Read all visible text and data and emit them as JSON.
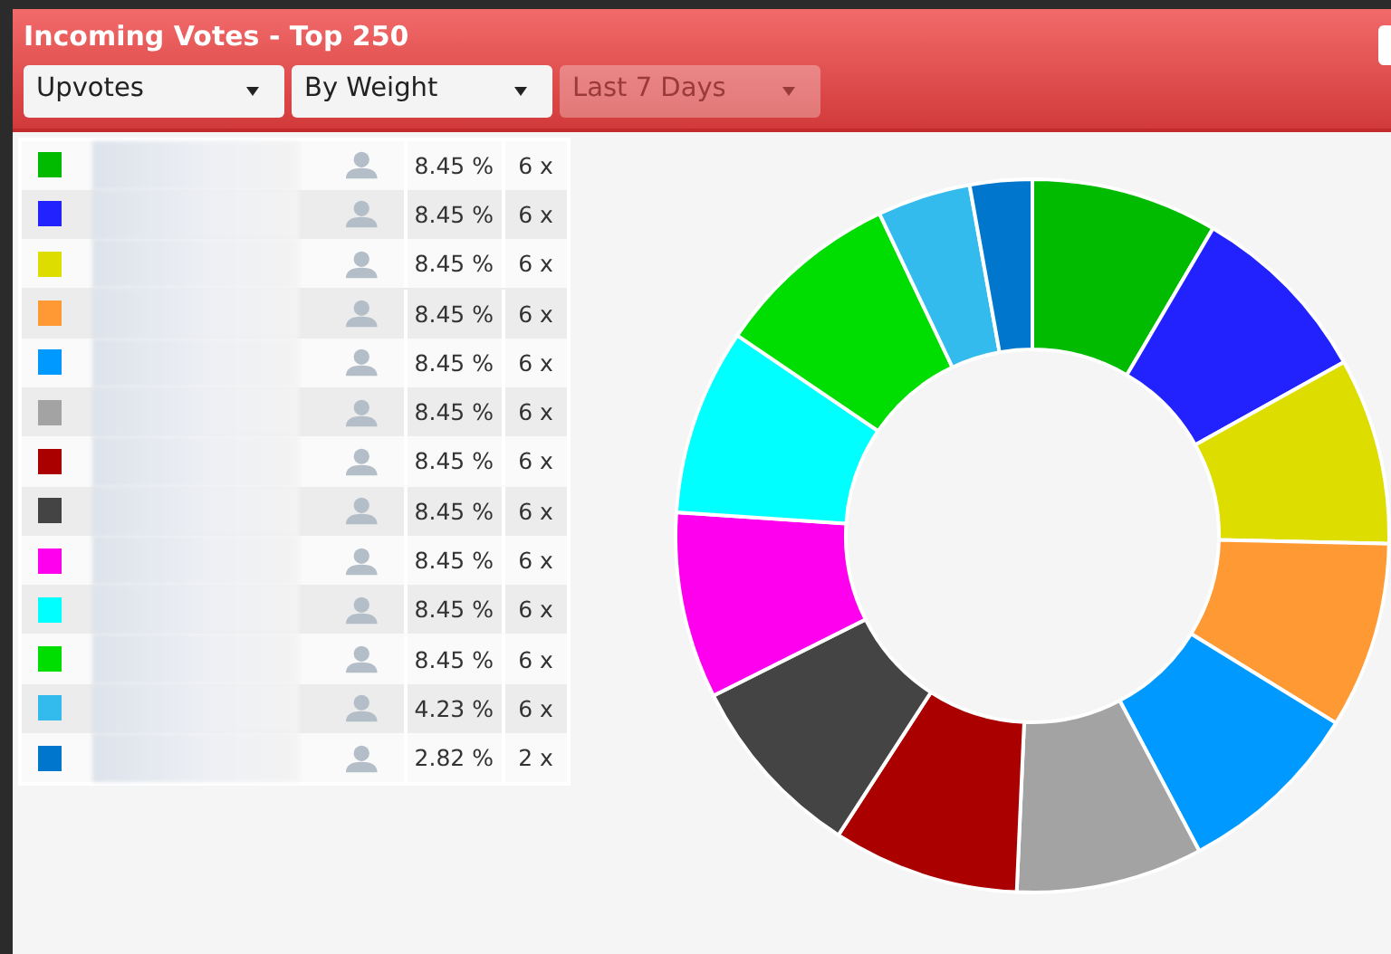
{
  "panel": {
    "title": "Incoming Votes - Top 250"
  },
  "filters": [
    {
      "value": "Upvotes",
      "disabled": false
    },
    {
      "value": "By Weight",
      "disabled": false
    },
    {
      "value": "Last 7 Days",
      "disabled": true
    }
  ],
  "rows": [
    {
      "color": "#00bb00",
      "share": "8.45 %",
      "count": "6 x"
    },
    {
      "color": "#2222ff",
      "share": "8.45 %",
      "count": "6 x"
    },
    {
      "color": "#dddd00",
      "share": "8.45 %",
      "count": "6 x"
    },
    {
      "color": "#ff9933",
      "share": "8.45 %",
      "count": "6 x"
    },
    {
      "color": "#0099ff",
      "share": "8.45 %",
      "count": "6 x"
    },
    {
      "color": "#a3a3a3",
      "share": "8.45 %",
      "count": "6 x"
    },
    {
      "color": "#aa0000",
      "share": "8.45 %",
      "count": "6 x"
    },
    {
      "color": "#444444",
      "share": "8.45 %",
      "count": "6 x"
    },
    {
      "color": "#ff00ee",
      "share": "8.45 %",
      "count": "6 x"
    },
    {
      "color": "#00ffff",
      "share": "8.45 %",
      "count": "6 x"
    },
    {
      "color": "#00dd00",
      "share": "8.45 %",
      "count": "6 x"
    },
    {
      "color": "#33bbee",
      "share": "4.23 %",
      "count": "6 x"
    },
    {
      "color": "#0077cc",
      "share": "2.82 %",
      "count": "2 x"
    }
  ]
}
